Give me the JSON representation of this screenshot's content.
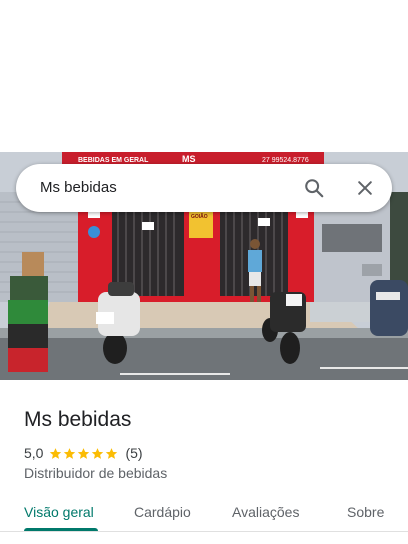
{
  "search": {
    "query": "Ms bebidas"
  },
  "storefront": {
    "sign_left": "BEBIDAS EM GERAL",
    "sign_logo": "MS",
    "sign_phone": "27 99524.8776",
    "poster": "GOIÃO"
  },
  "place": {
    "name": "Ms bebidas",
    "rating": "5,0",
    "rating_value": 5.0,
    "review_count": "(5)",
    "category": "Distribuidor de bebidas"
  },
  "tabs": [
    {
      "label": "Visão geral",
      "active": true
    },
    {
      "label": "Cardápio",
      "active": false
    },
    {
      "label": "Avaliações",
      "active": false
    },
    {
      "label": "Sobre",
      "active": false
    }
  ],
  "colors": {
    "accent": "#00796b",
    "star": "#fbbc04",
    "storefront_red": "#d81d2a"
  }
}
